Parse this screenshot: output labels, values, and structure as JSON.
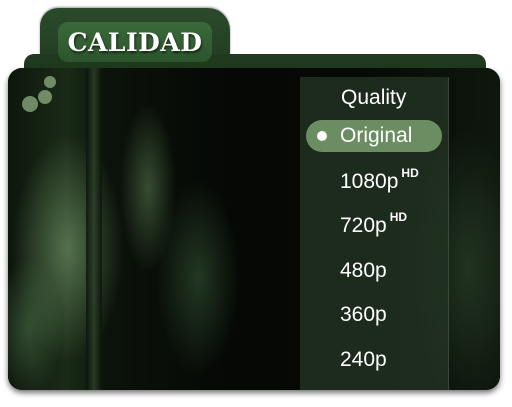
{
  "folder": {
    "tab_label": "CALIDAD",
    "accent_color": "#2c552c"
  },
  "menu": {
    "title": "Quality",
    "items": [
      {
        "label": "Original",
        "badge": "",
        "selected": true
      },
      {
        "label": "1080p",
        "badge": "HD",
        "selected": false
      },
      {
        "label": "720p",
        "badge": "HD",
        "selected": false
      },
      {
        "label": "480p",
        "badge": "",
        "selected": false
      },
      {
        "label": "360p",
        "badge": "",
        "selected": false
      },
      {
        "label": "240p",
        "badge": "",
        "selected": false
      }
    ]
  },
  "icons": {
    "selected_indicator": "radio-dot-icon"
  }
}
